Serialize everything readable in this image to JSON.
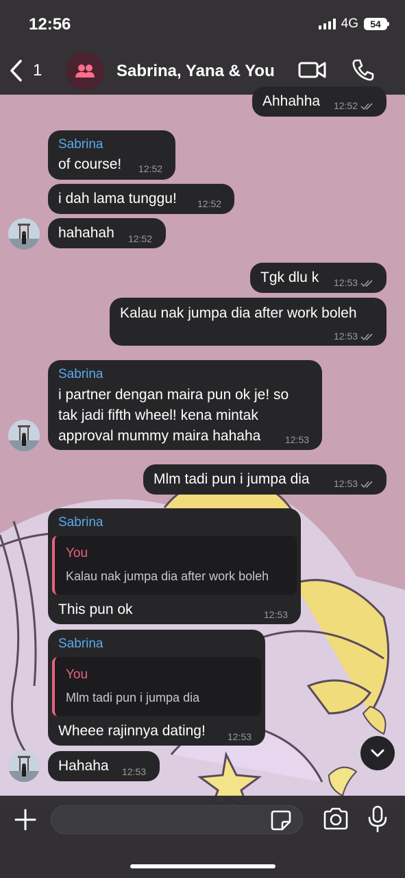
{
  "status": {
    "time": "12:56",
    "network": "4G",
    "battery": "54"
  },
  "header": {
    "back_count": "1",
    "title": "Sabrina, Yana & You"
  },
  "messages": {
    "m1": {
      "text": "Ahhahha",
      "time": "12:52"
    },
    "m2": {
      "sender": "Sabrina",
      "text": "of course!",
      "time": "12:52"
    },
    "m3": {
      "text": "i dah lama tunggu!",
      "time": "12:52"
    },
    "m4": {
      "text": "hahahah",
      "time": "12:52"
    },
    "m5": {
      "text": "Tgk dlu k",
      "time": "12:53"
    },
    "m6": {
      "text": "Kalau nak jumpa dia after work boleh",
      "time": "12:53"
    },
    "m7": {
      "sender": "Sabrina",
      "lines": [
        "i partner dengan maira pun ok je! so",
        "tak jadi fifth wheel! kena mintak",
        "approval mummy maira hahaha"
      ],
      "time": "12:53"
    },
    "m8": {
      "text": "Mlm tadi pun i jumpa dia",
      "time": "12:53"
    },
    "m9": {
      "sender": "Sabrina",
      "quote_name": "You",
      "quote_text": "Kalau nak jumpa dia after work boleh",
      "text": "This pun ok",
      "time": "12:53"
    },
    "m10": {
      "sender": "Sabrina",
      "quote_name": "You",
      "quote_text": "Mlm tadi pun i jumpa dia",
      "text": "Wheee rajinnya dating!",
      "time": "12:53"
    },
    "m11": {
      "text": "Hahaha",
      "time": "12:53"
    }
  },
  "composer": {
    "placeholder": ""
  },
  "colors": {
    "sender": "#5aa9ee",
    "quote_accent": "#e8637d",
    "bubble": "#262628",
    "wallpaper": "#c9a2b3"
  },
  "icons": [
    "back-chevron-icon",
    "group-icon",
    "video-call-icon",
    "phone-icon",
    "plus-icon",
    "sticker-icon",
    "camera-icon",
    "microphone-icon",
    "chevron-down-icon",
    "read-ticks-icon"
  ]
}
